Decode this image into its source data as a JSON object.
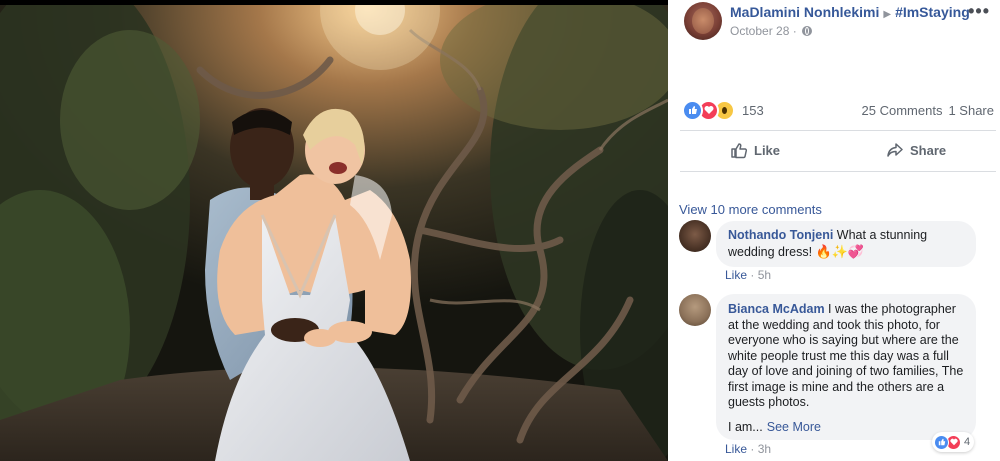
{
  "post": {
    "author": "MaDlamini Nonhlekimi",
    "group": "#ImStaying",
    "date": "October 28",
    "more_label": "•••"
  },
  "reactions": {
    "types": [
      "like-icon",
      "love-icon",
      "wow-icon"
    ],
    "count": "153",
    "comments": "25 Comments",
    "shares": "1 Share"
  },
  "actions": {
    "like_label": "Like",
    "share_label": "Share"
  },
  "comments": {
    "view_more": "View 10 more comments",
    "items": [
      {
        "name": "Nothando Tonjeni",
        "text": "What a stunning wedding dress!",
        "emojis": "🔥✨💞",
        "like_label": "Like",
        "time": "5h"
      },
      {
        "name": "Bianca McAdam",
        "text": "I was the photographer at the wedding and took this photo, for everyone who is saying but where are the white people trust me this day was a full day of love and joining of two families, The first image is mine and the others are a guests photos.",
        "truncated": "I am...",
        "see_more": "See More",
        "like_label": "Like",
        "time": "3h",
        "reaction_count": "4"
      }
    ]
  },
  "colors": {
    "link": "#385898",
    "name": "#365899",
    "meta": "#90949c",
    "bubble": "#f2f3f5",
    "like_blue": "#4a8cf0",
    "love_red": "#f33e58",
    "wow_yellow": "#f7c744"
  }
}
